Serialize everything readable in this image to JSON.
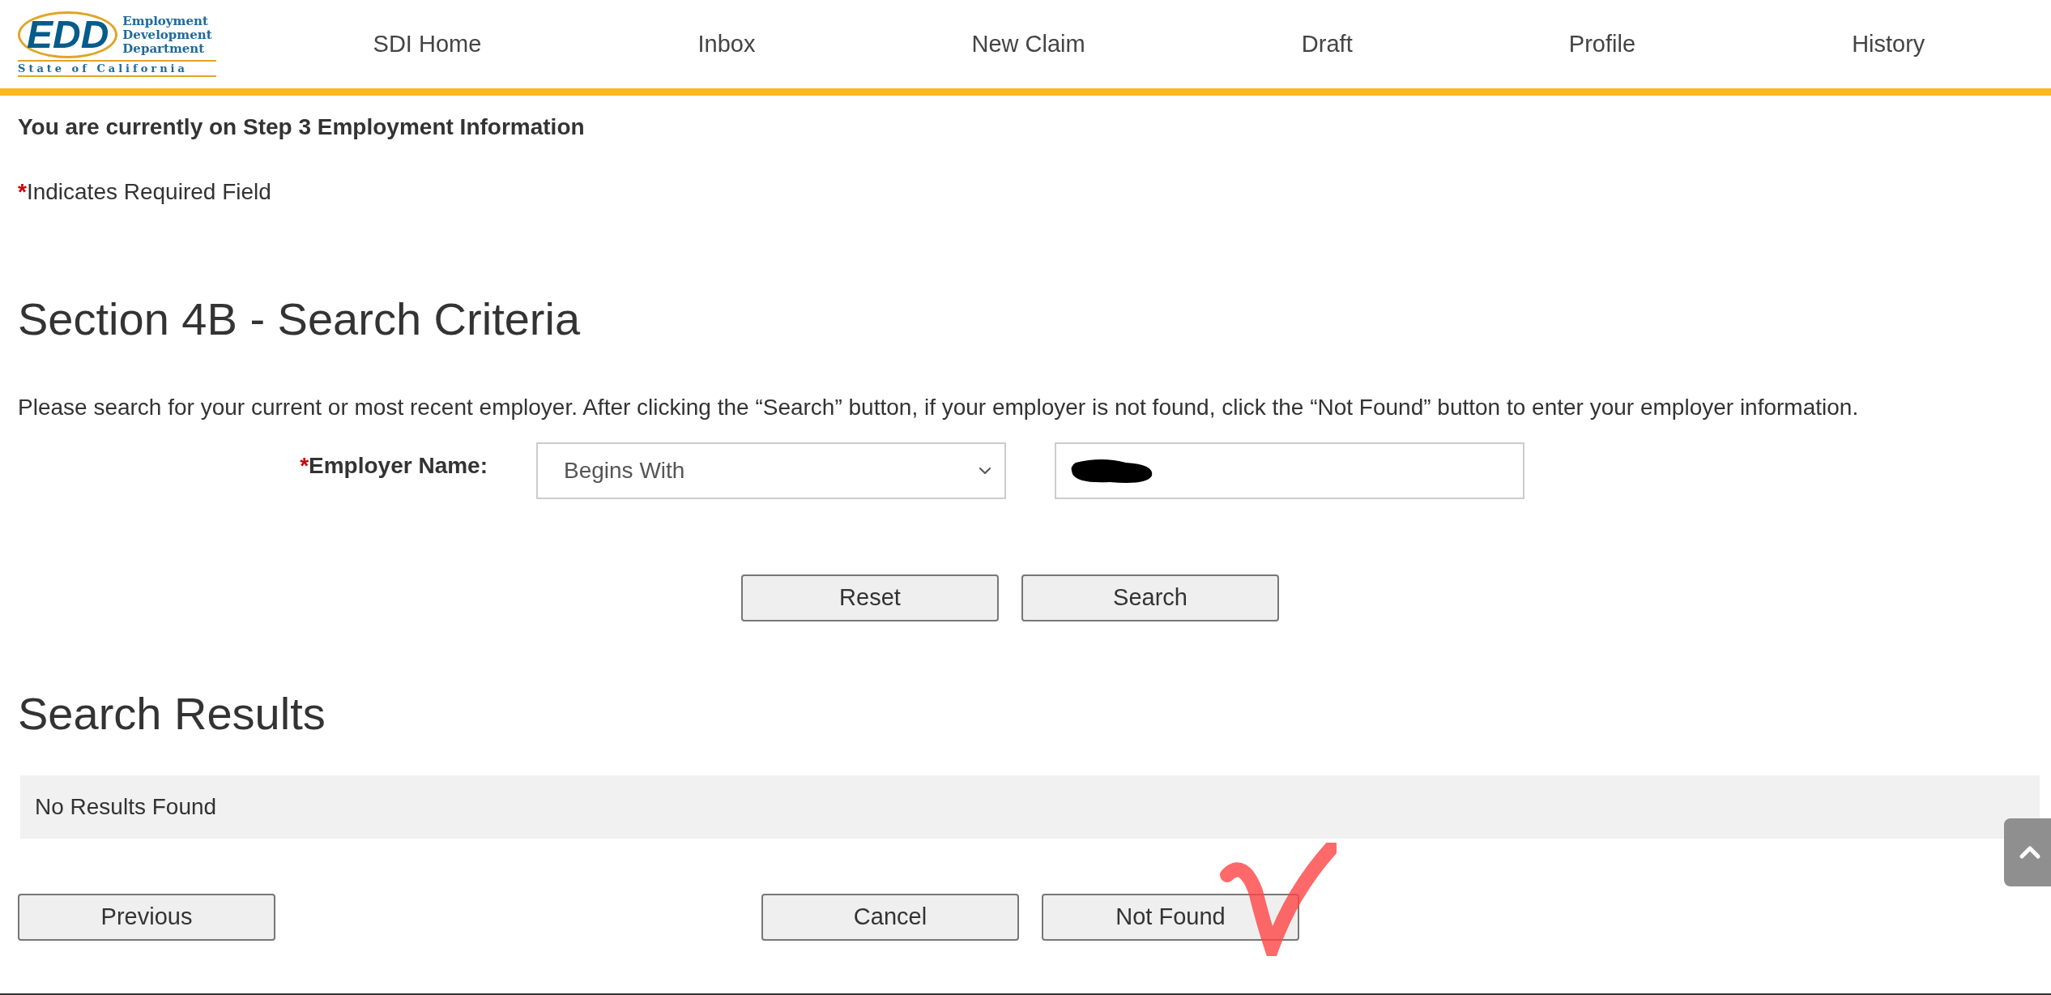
{
  "logo": {
    "letters": "EDD",
    "lines": [
      "Employment",
      "Development",
      "Department"
    ],
    "state": "State of California"
  },
  "nav": [
    {
      "label": "SDI Home"
    },
    {
      "label": "Inbox"
    },
    {
      "label": "New Claim"
    },
    {
      "label": "Draft"
    },
    {
      "label": "Profile"
    },
    {
      "label": "History"
    }
  ],
  "step_notice": "You are currently on Step 3 Employment Information",
  "required_note": {
    "mark": "*",
    "text": "Indicates Required Field"
  },
  "section": {
    "title": "Section 4B - Search Criteria",
    "instructions": "Please search for your current or most recent employer. After clicking the “Search” button, if your employer is not found, click the “Not Found” button to enter your employer information.",
    "employer": {
      "mark": "*",
      "label": "Employer Name:",
      "match_value": "Begins With",
      "name_redacted": true
    },
    "buttons": [
      "Reset",
      "Search"
    ]
  },
  "results": {
    "title": "Search Results",
    "message": "No Results Found"
  },
  "footer_buttons": [
    "Previous",
    "Cancel",
    "Not Found"
  ],
  "annotation": {
    "checked": true
  }
}
